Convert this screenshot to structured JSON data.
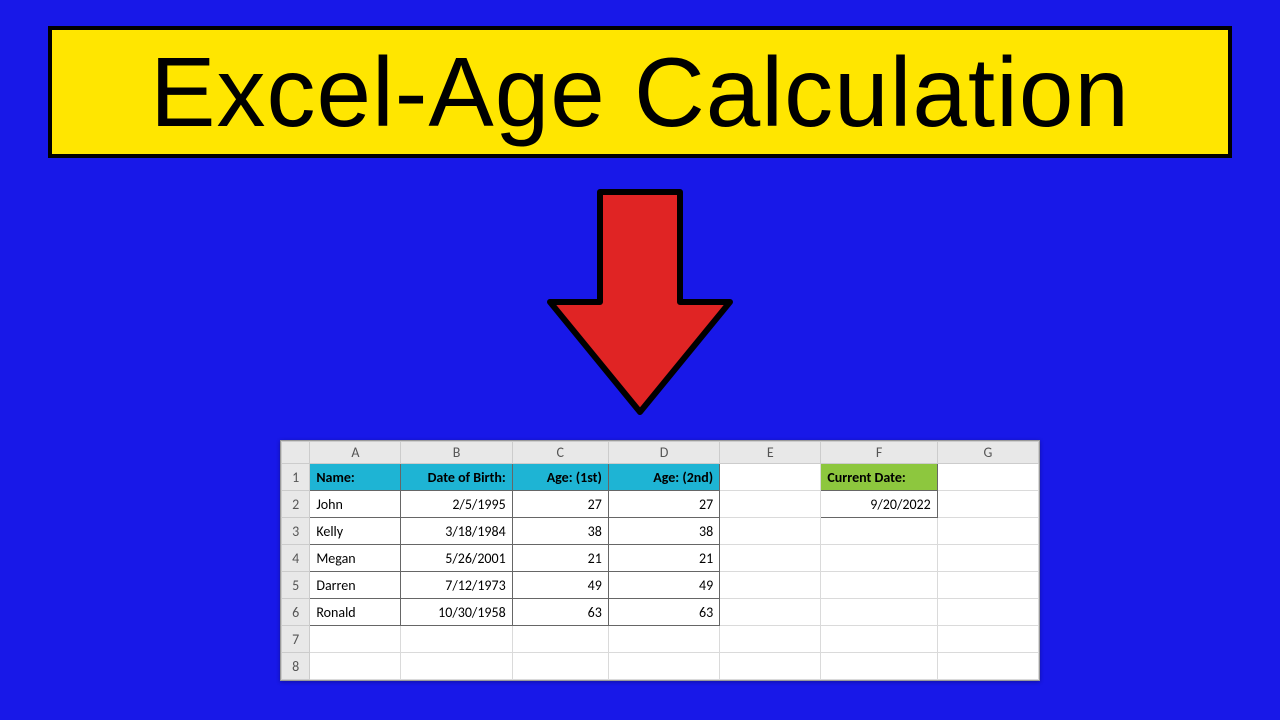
{
  "title": "Excel-Age Calculation",
  "columns": [
    "A",
    "B",
    "C",
    "D",
    "E",
    "F",
    "G"
  ],
  "row_numbers": [
    1,
    2,
    3,
    4,
    5,
    6,
    7,
    8
  ],
  "headers": {
    "name": "Name:",
    "dob": "Date of Birth:",
    "age1": "Age: (1st)",
    "age2": "Age: (2nd)",
    "curdate_label": "Current Date:"
  },
  "current_date": "9/20/2022",
  "people": [
    {
      "name": "John",
      "dob": "2/5/1995",
      "age1": 27,
      "age2": 27
    },
    {
      "name": "Kelly",
      "dob": "3/18/1984",
      "age1": 38,
      "age2": 38
    },
    {
      "name": "Megan",
      "dob": "5/26/2001",
      "age1": 21,
      "age2": 21
    },
    {
      "name": "Darren",
      "dob": "7/12/1973",
      "age1": 49,
      "age2": 49
    },
    {
      "name": "Ronald",
      "dob": "10/30/1958",
      "age1": 63,
      "age2": 63
    }
  ]
}
